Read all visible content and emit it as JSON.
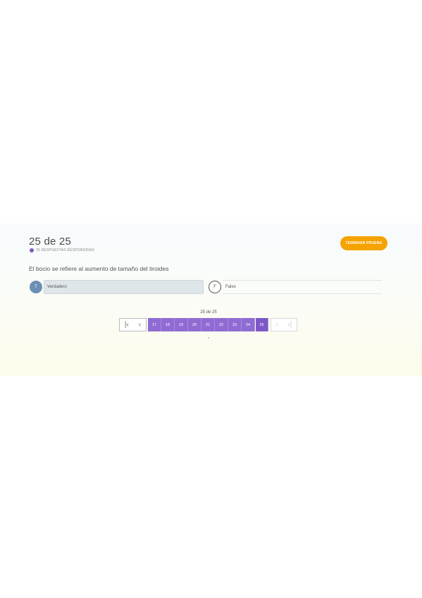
{
  "quiz": {
    "counter": "25 de 25",
    "status": "25 RESPUESTAS RESPONDIDAS",
    "finish_button": "TERMINAR PRUEBA",
    "question": "El bocio se refiere al aumento de tamaño del tiroides",
    "options": [
      {
        "letter": "T",
        "label": "Verdadero",
        "selected": true
      },
      {
        "letter": "F",
        "label": "Falso",
        "selected": false
      }
    ]
  },
  "pagination": {
    "indicator": "25 de 25",
    "pages": [
      "17",
      "18",
      "19",
      "20",
      "21",
      "22",
      "23",
      "24",
      "25"
    ],
    "current": "25"
  },
  "colors": {
    "accent_orange": "#f5a300",
    "page_purple": "#8f6bd3",
    "selected_option": "#dfe6ea"
  }
}
